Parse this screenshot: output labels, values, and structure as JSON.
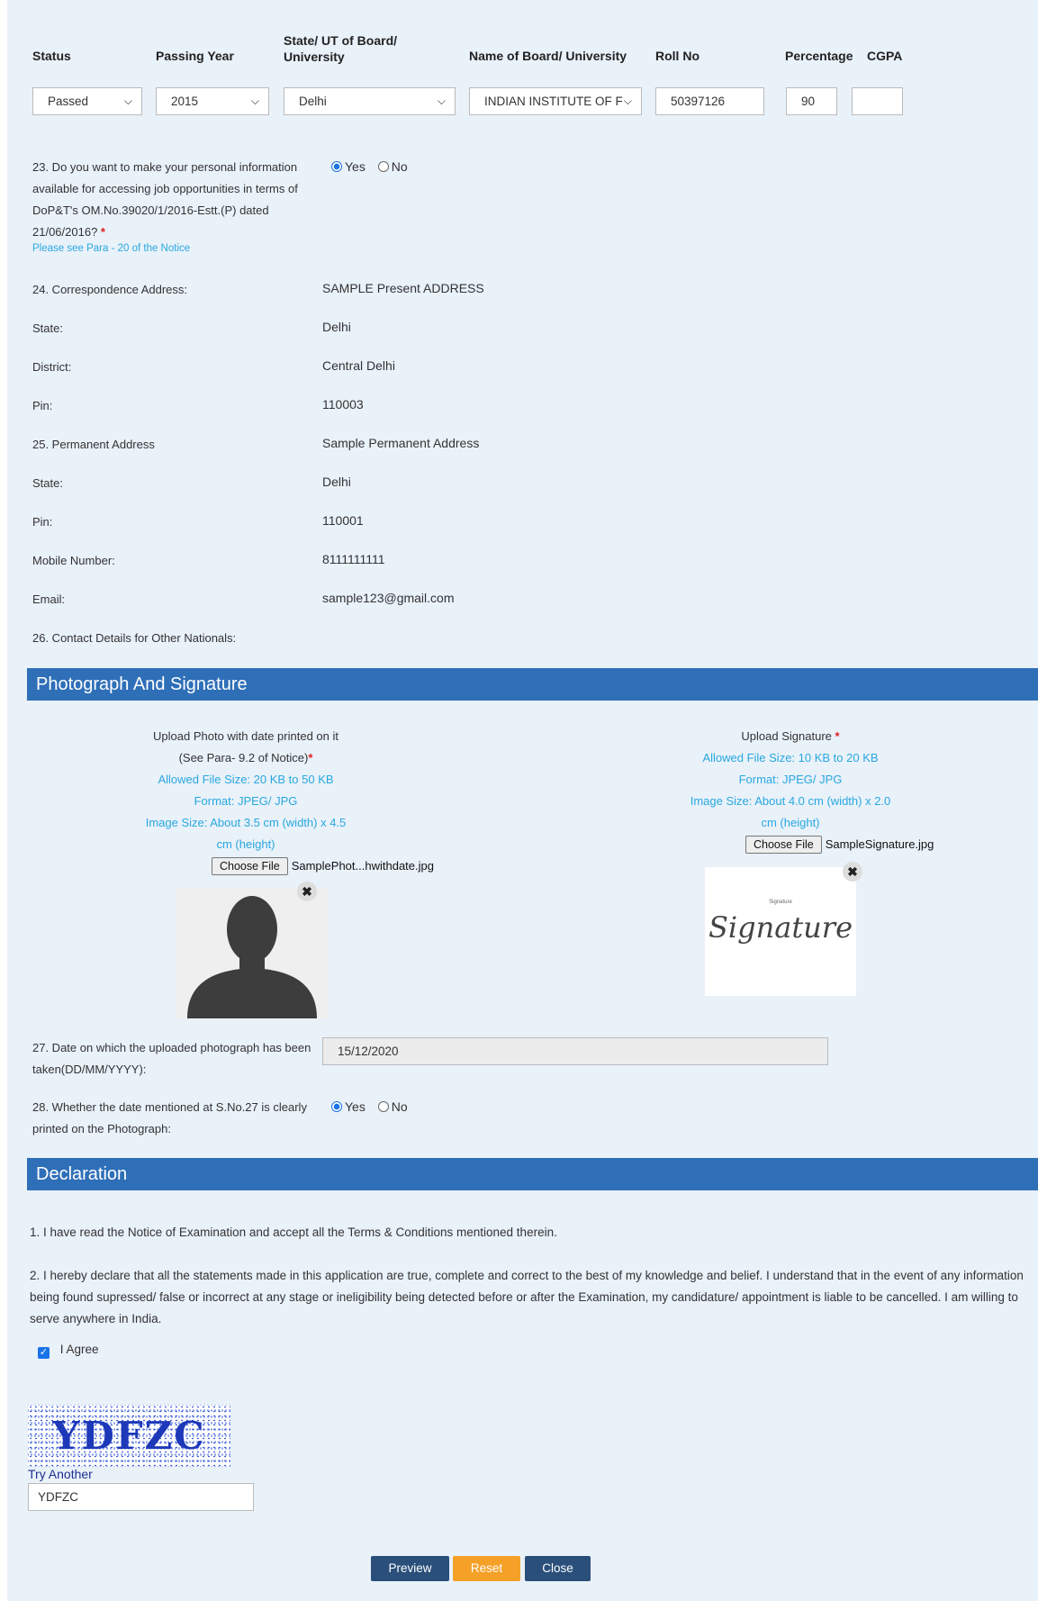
{
  "education": {
    "headers": {
      "status": "Status",
      "passing_year": "Passing Year",
      "state_ut_line1": "State/ UT of Board/",
      "state_ut_line2": "University",
      "board": "Name of Board/ University",
      "roll": "Roll No",
      "percentage": "Percentage",
      "cgpa": "CGPA"
    },
    "row": {
      "status": "Passed",
      "passing_year": "2015",
      "state": "Delhi",
      "board": "INDIAN INSTITUTE OF F",
      "roll": "50397126",
      "percentage": "90",
      "cgpa": ""
    }
  },
  "q23": {
    "line1": "23. Do you want to make your personal information",
    "line2": "available for accessing job opportunities in terms of",
    "line3": "DoP&T's OM.No.39020/1/2016-Estt.(P) dated",
    "line4": "21/06/2016?",
    "required": "*",
    "note": "Please see Para - 20 of the Notice",
    "yes": "Yes",
    "no": "No",
    "selected": "Yes"
  },
  "address": [
    {
      "label": "24. Correspondence Address:",
      "value": "SAMPLE Present ADDRESS"
    },
    {
      "label": "State:",
      "value": "Delhi"
    },
    {
      "label": "District:",
      "value": "Central Delhi"
    },
    {
      "label": "Pin:",
      "value": "110003"
    },
    {
      "label": "25. Permanent Address",
      "value": "Sample Permanent Address"
    },
    {
      "label": "State:",
      "value": "Delhi"
    },
    {
      "label": "Pin:",
      "value": "110001"
    },
    {
      "label": "Mobile Number:",
      "value": "8111111111"
    },
    {
      "label": "Email:",
      "value": "sample123@gmail.com"
    },
    {
      "label": "26. Contact Details for Other Nationals:",
      "value": ""
    }
  ],
  "photo_section": {
    "title": "Photograph And Signature",
    "photo": {
      "line1": "Upload Photo with date printed on it",
      "line2": "(See Para- 9.2 of Notice)",
      "required": "*",
      "size": "Allowed File Size: 20 KB to 50 KB",
      "format": "Format: JPEG/ JPG",
      "dims1": "Image Size: About 3.5 cm (width) x 4.5",
      "dims2": "cm (height)",
      "choose": "Choose File",
      "filename": "SamplePhot...hwithdate.jpg"
    },
    "signature": {
      "line1": "Upload Signature",
      "required": "*",
      "size": "Allowed File Size: 10 KB to 20 KB",
      "format": "Format: JPEG/ JPG",
      "dims1": "Image Size: About 4.0 cm (width) x 2.0",
      "dims2": "cm (height)",
      "choose": "Choose File",
      "filename": "SampleSignature.jpg",
      "image_text": "Signature",
      "image_caption": "Signature"
    },
    "remove_glyph": "✖"
  },
  "q27": {
    "line1": "27. Date on which the uploaded photograph has been",
    "line2": "taken(DD/MM/YYYY):",
    "value": "15/12/2020"
  },
  "q28": {
    "line1": "28. Whether the date mentioned at S.No.27 is clearly",
    "line2": "printed on the Photograph:",
    "yes": "Yes",
    "no": "No",
    "selected": "Yes"
  },
  "declaration": {
    "title": "Declaration",
    "p1": "1. I have read the Notice of Examination and accept all the Terms & Conditions mentioned therein.",
    "p2": "2. I hereby declare that all the statements made in this application are true, complete and correct to the best of my knowledge and belief. I understand that in the event of any information being found supressed/ false or incorrect at any stage or ineligibility being detected before or after the Examination, my candidature/ appointment is liable to be cancelled. I am willing to serve anywhere in India.",
    "agree": "I Agree",
    "agree_checked": true
  },
  "captcha": {
    "code": "YDFZC",
    "try_another": "Try Another",
    "input_value": "YDFZC"
  },
  "buttons": {
    "preview": "Preview",
    "reset": "Reset",
    "close": "Close"
  },
  "colors": {
    "background": "#e9f1f9",
    "section_bar": "#2f6fb8",
    "link": "#29a8e0",
    "required": "#e02020",
    "preview_btn": "#2a4f7a",
    "reset_btn": "#f5a127",
    "close_btn": "#2a4f7a"
  }
}
